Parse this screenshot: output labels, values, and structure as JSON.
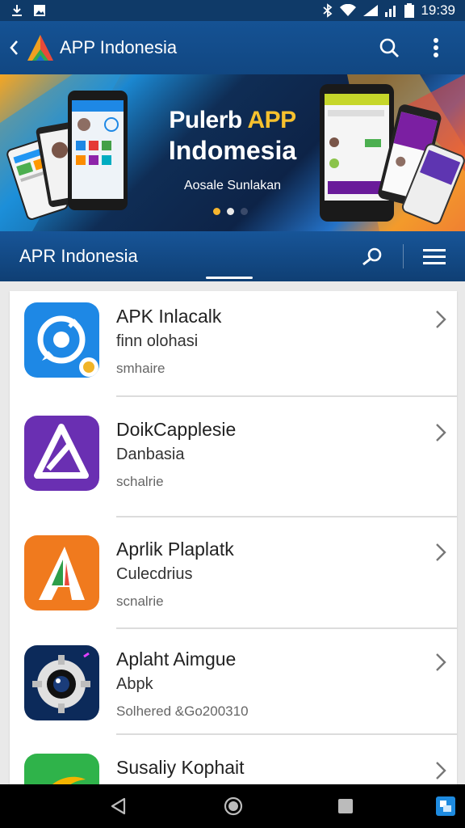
{
  "status_bar": {
    "time": "19:39"
  },
  "app_bar": {
    "title": "APP Indonesia"
  },
  "banner": {
    "title_part1": "Pulerb ",
    "title_accent": "APP",
    "title_line2": "Indomesia",
    "subtitle": "Aosale Sunlakan",
    "dots": 3,
    "active_dot": 0
  },
  "section": {
    "title": "APR Indonesia"
  },
  "list": {
    "items": [
      {
        "title": "APK Inlacalk",
        "subtitle": "finn olohasi",
        "meta": "smhaire",
        "icon": "chat-app-icon"
      },
      {
        "title": "DoikCapplesie",
        "subtitle": "Danbasia",
        "meta": "schalrie",
        "icon": "delta-app-icon"
      },
      {
        "title": "Aprlik Plaplatk",
        "subtitle": "Culecdrius",
        "meta": "scnalrie",
        "icon": "a-letter-app-icon"
      },
      {
        "title": "Aplaht Aimgue",
        "subtitle": "Abpk",
        "meta": "Solhered  &Go200310",
        "icon": "camera-gear-app-icon"
      },
      {
        "title": "Susaliy Kophait",
        "subtitle": "",
        "meta": "",
        "icon": "green-app-icon"
      }
    ]
  },
  "colors": {
    "app_bar": "#155294",
    "accent": "#f6c12e"
  }
}
